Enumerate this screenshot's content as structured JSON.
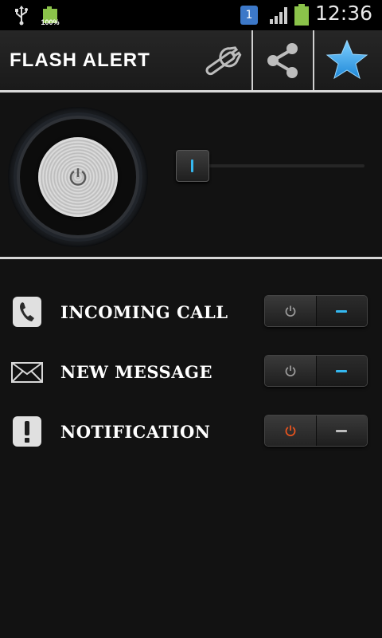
{
  "status_bar": {
    "battery_small_label": "100%",
    "sim_number": "1",
    "time": "12:36"
  },
  "action_bar": {
    "title": "FLASH ALERT",
    "icons": [
      "wrench-icon",
      "share-icon",
      "star-icon"
    ]
  },
  "flash_panel": {
    "power_icon": "power-icon",
    "slider_level": 0.0
  },
  "alerts": [
    {
      "label": "INCOMING CALL",
      "icon": "phone-icon",
      "state": "off"
    },
    {
      "label": "NEW MESSAGE",
      "icon": "envelope-icon",
      "state": "off"
    },
    {
      "label": "NOTIFICATION",
      "icon": "exclamation-icon",
      "state": "on"
    }
  ],
  "colors": {
    "accent_blue": "#35b8f0",
    "on_orange": "#e8541e",
    "battery_green": "#8bc34a",
    "star_blue": "#3fa9f5"
  }
}
